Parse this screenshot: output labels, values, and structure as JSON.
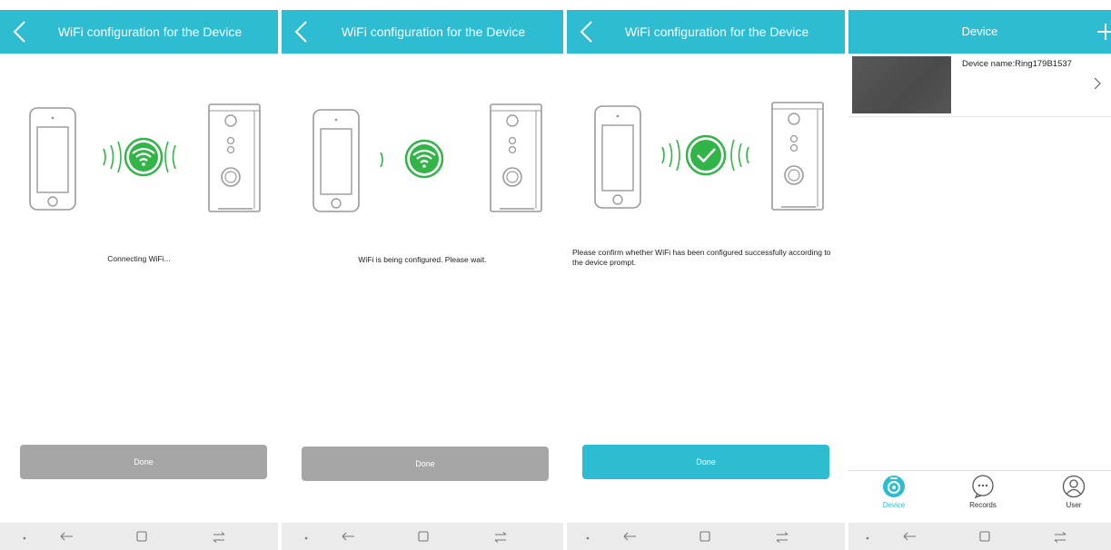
{
  "colors": {
    "accent": "#2dbcd2",
    "wifi_green": "#32b548",
    "button_disabled": "#a6a6a6",
    "navbar_bg": "#ebebeb"
  },
  "icons": {
    "back": "chevron-left-icon",
    "add": "plus-icon",
    "wifi": "wifi-icon",
    "check": "checkmark-icon",
    "chevron": "chevron-right-icon",
    "nav": [
      "dot-icon",
      "back-arrow-icon",
      "home-square-icon",
      "recents-icon"
    ]
  },
  "screens": [
    {
      "header": {
        "title": "WiFi configuration for the Device"
      },
      "status": "Connecting WiFi...",
      "button": {
        "label": "Done",
        "enabled": false
      }
    },
    {
      "header": {
        "title": "WiFi configuration for the Device"
      },
      "status": "WiFi is being configured. Please wait.",
      "button": {
        "label": "Done",
        "enabled": false
      }
    },
    {
      "header": {
        "title": "WiFi configuration for the Device"
      },
      "status": "Please confirm whether WiFi has been configured successfully according to the device prompt.",
      "button": {
        "label": "Done",
        "enabled": true
      }
    }
  ],
  "device_list": {
    "header": {
      "title": "Device"
    },
    "items": [
      {
        "name": "Device name:Ring179B1537"
      }
    ],
    "tabs": [
      {
        "label": "Device",
        "active": true
      },
      {
        "label": "Records",
        "active": false
      },
      {
        "label": "User",
        "active": false
      }
    ]
  }
}
